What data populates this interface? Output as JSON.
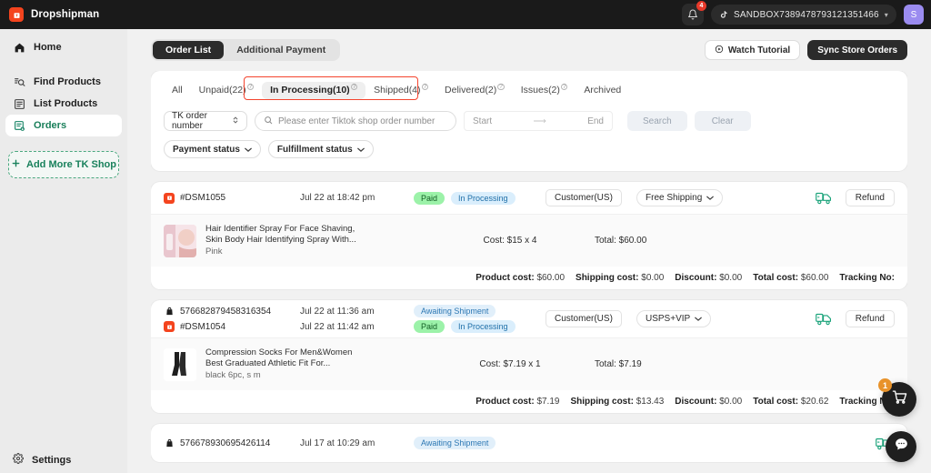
{
  "topbar": {
    "brand_name": "Dropshipman",
    "notification_count": "4",
    "shop_name": "SANDBOX7389478793121351466",
    "avatar_initial": "S"
  },
  "sidebar": {
    "home": {
      "label": "Home",
      "icon": "home-icon"
    },
    "items": [
      {
        "label": "Find Products",
        "icon": "find-products-icon",
        "active": false
      },
      {
        "label": "List Products",
        "icon": "list-products-icon",
        "active": false
      },
      {
        "label": "Orders",
        "icon": "orders-icon",
        "active": true
      }
    ],
    "add_shop_label": "Add More TK Shop",
    "settings_label": "Settings"
  },
  "header": {
    "tabs": [
      {
        "label": "Order List",
        "active": true
      },
      {
        "label": "Additional Payment",
        "active": false
      }
    ],
    "watch_tutorial_label": "Watch Tutorial",
    "sync_orders_label": "Sync Store Orders"
  },
  "filters": {
    "status_tabs": [
      {
        "label": "All",
        "has_help": false,
        "active": false
      },
      {
        "label": "Unpaid(22)",
        "has_help": true,
        "active": false
      },
      {
        "label": "In Processing(10)",
        "has_help": true,
        "active": true
      },
      {
        "label": "Shipped(4)",
        "has_help": true,
        "active": false
      },
      {
        "label": "Delivered(2)",
        "has_help": true,
        "active": false
      },
      {
        "label": "Issues(2)",
        "has_help": true,
        "active": false
      },
      {
        "label": "Archived",
        "has_help": false,
        "active": false
      }
    ],
    "highlight_color": "#f4442e",
    "order_type_select": "TK order number",
    "search_placeholder": "Please enter Tiktok shop order number",
    "search_value": "",
    "date_start_placeholder": "Start",
    "date_end_placeholder": "End",
    "search_button": "Search",
    "clear_button": "Clear",
    "payment_status_label": "Payment status",
    "fulfillment_status_label": "Fulfillment status"
  },
  "orders": [
    {
      "shop_order_no": "",
      "shop_order_date": "",
      "shop_status": "",
      "dsm_order_no": "#DSM1055",
      "dsm_order_date": "Jul 22 at 18:42 pm",
      "payment_badge": "Paid",
      "fulfillment_badge": "In Processing",
      "customer": "Customer(US)",
      "shipping": "Free Shipping",
      "refund_label": "Refund",
      "product": {
        "title_line1": "Hair Identifier Spray For Face Shaving,",
        "title_line2": "Skin Body Hair Identifying Spray With...",
        "variant": "Pink",
        "cost": "Cost: $15 x 4",
        "total": "Total: $60.00",
        "thumb_colors": [
          "#f3d9de",
          "#e7bfc8"
        ]
      },
      "footer": {
        "product_cost_label": "Product cost:",
        "product_cost": "$60.00",
        "shipping_cost_label": "Shipping cost:",
        "shipping_cost": "$0.00",
        "discount_label": "Discount:",
        "discount": "$0.00",
        "total_cost_label": "Total cost:",
        "total_cost": "$60.00",
        "tracking_label": "Tracking No:",
        "tracking_no": ""
      }
    },
    {
      "shop_order_no": "576682879458316354",
      "shop_order_date": "Jul 22 at 11:36 am",
      "shop_status": "Awaiting Shipment",
      "dsm_order_no": "#DSM1054",
      "dsm_order_date": "Jul 22 at 11:42 am",
      "payment_badge": "Paid",
      "fulfillment_badge": "In Processing",
      "customer": "Customer(US)",
      "shipping": "USPS+VIP",
      "refund_label": "Refund",
      "product": {
        "title_line1": "Compression Socks For Men&Women",
        "title_line2": "Best Graduated Athletic Fit For...",
        "variant": "black 6pc, s m",
        "cost": "Cost: $7.19 x 1",
        "total": "Total: $7.19",
        "thumb_colors": [
          "#ffffff",
          "#1e1e1e"
        ]
      },
      "footer": {
        "product_cost_label": "Product cost:",
        "product_cost": "$7.19",
        "shipping_cost_label": "Shipping cost:",
        "shipping_cost": "$13.43",
        "discount_label": "Discount:",
        "discount": "$0.00",
        "total_cost_label": "Total cost:",
        "total_cost": "$20.62",
        "tracking_label": "Tracking No:",
        "tracking_no": ""
      }
    },
    {
      "shop_order_no": "576678930695426114",
      "shop_order_date": "Jul 17 at 10:29 am",
      "shop_status": "Awaiting Shipment",
      "dsm_order_no": "",
      "dsm_order_date": "",
      "payment_badge": "",
      "fulfillment_badge": "",
      "customer": "",
      "shipping": "",
      "refund_label": "",
      "product": null,
      "footer": null
    }
  ],
  "fabs": {
    "cart_badge": "1",
    "cart_icon": "shopping-cart-icon",
    "chat_icon": "chat-bubble-icon"
  }
}
